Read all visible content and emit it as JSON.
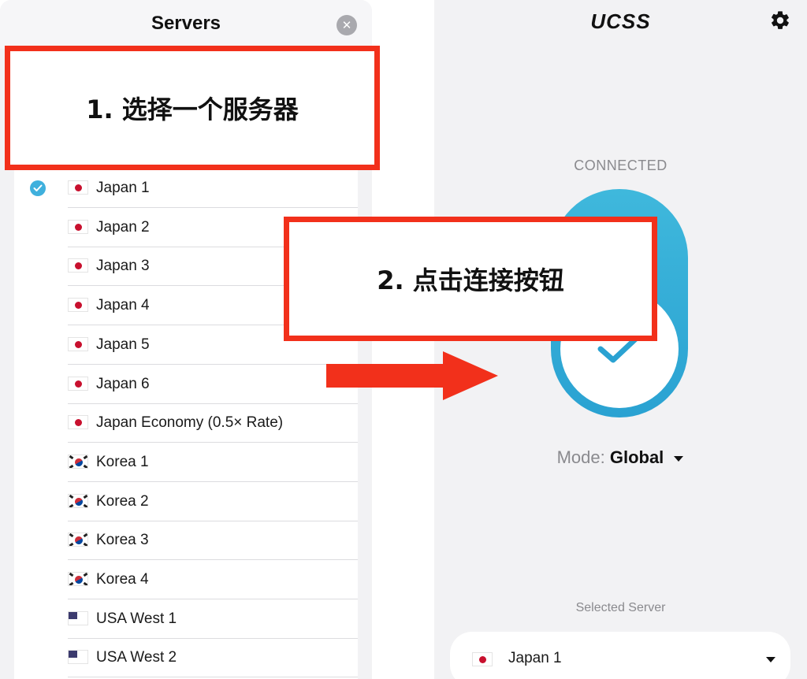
{
  "servers_panel": {
    "title": "Servers",
    "close_icon": "close-icon",
    "items": [
      {
        "name": "Japan 1",
        "flag": "jp",
        "selected": true
      },
      {
        "name": "Japan 2",
        "flag": "jp",
        "selected": false
      },
      {
        "name": "Japan 3",
        "flag": "jp",
        "selected": false
      },
      {
        "name": "Japan 4",
        "flag": "jp",
        "selected": false
      },
      {
        "name": "Japan 5",
        "flag": "jp",
        "selected": false
      },
      {
        "name": "Japan 6",
        "flag": "jp",
        "selected": false
      },
      {
        "name": "Japan Economy (0.5× Rate)",
        "flag": "jp",
        "selected": false
      },
      {
        "name": "Korea 1",
        "flag": "kr",
        "selected": false
      },
      {
        "name": "Korea 2",
        "flag": "kr",
        "selected": false
      },
      {
        "name": "Korea 3",
        "flag": "kr",
        "selected": false
      },
      {
        "name": "Korea 4",
        "flag": "kr",
        "selected": false
      },
      {
        "name": "USA West 1",
        "flag": "us",
        "selected": false
      },
      {
        "name": "USA West 2",
        "flag": "us",
        "selected": false
      }
    ]
  },
  "main_screen": {
    "logo": "UCSS",
    "settings_icon": "gear-icon",
    "status": "CONNECTED",
    "connected": true,
    "mode_label": "Mode:",
    "mode_value": "Global",
    "selected_server_label": "Selected Server",
    "selected_server": "Japan 1",
    "selected_server_flag": "jp"
  },
  "annotations": {
    "step1": "1. 选择一个服务器",
    "step2": "2. 点击连接按钮"
  },
  "colors": {
    "accent": "#2aa2d2",
    "annotation_red": "#f2301b",
    "check": "#3fb0dd",
    "background": "#f2f2f4"
  }
}
